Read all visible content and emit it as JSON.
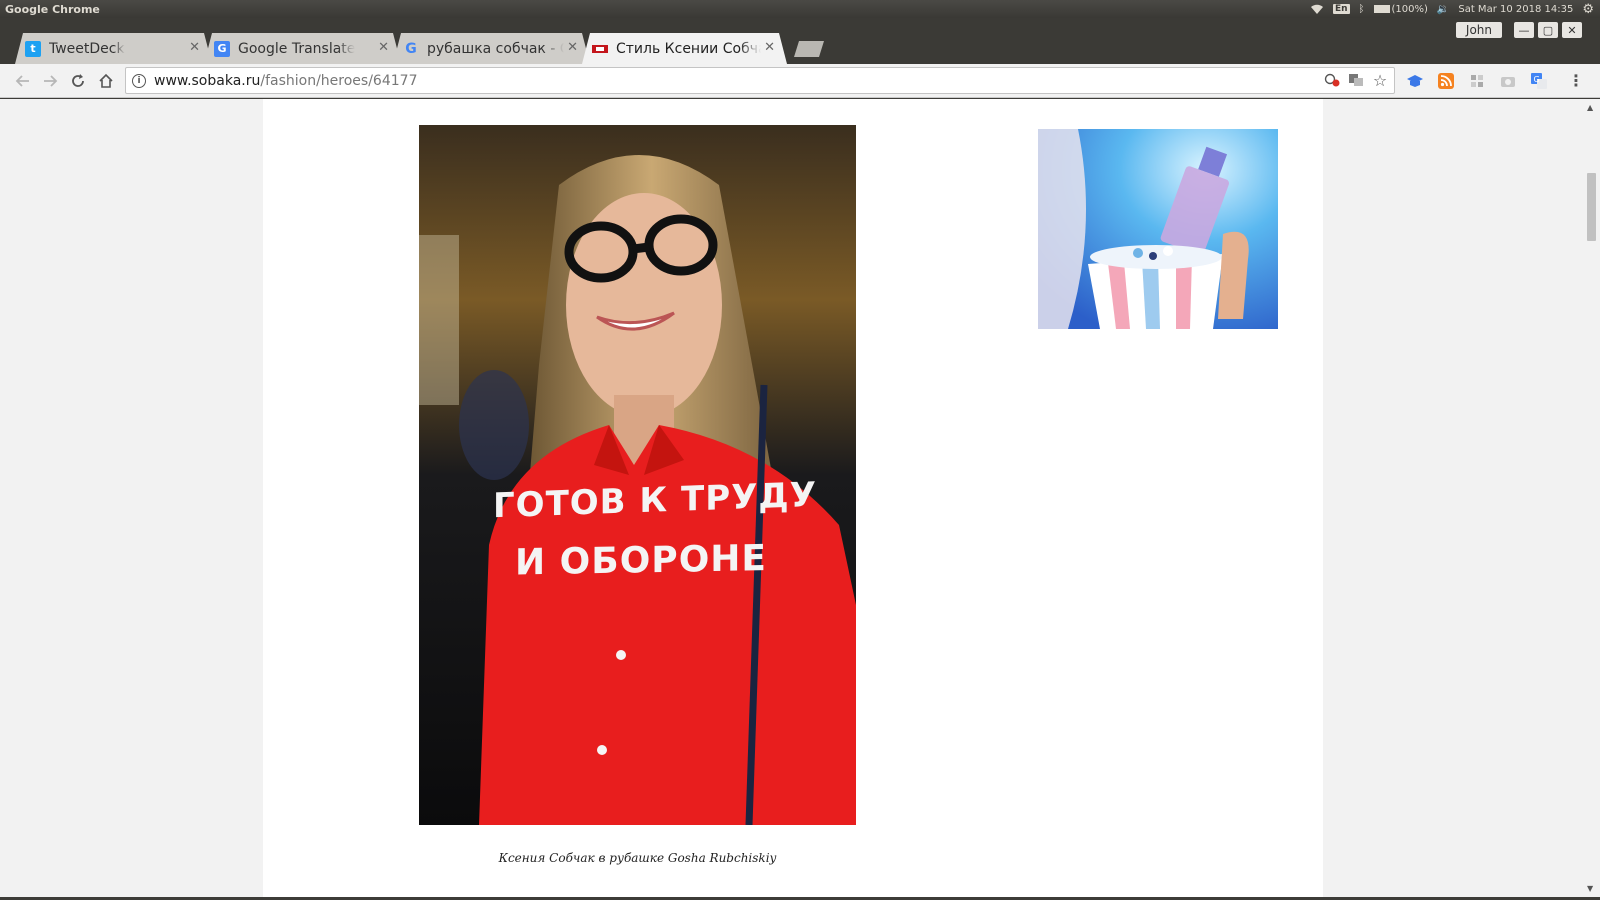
{
  "os_panel": {
    "app_name": "Google Chrome",
    "keyboard_layout": "En",
    "battery": "(100%)",
    "datetime": "Sat Mar 10 2018 14:35"
  },
  "browser": {
    "profile_name": "John",
    "tabs": [
      {
        "label": "TweetDeck",
        "favicon": "twitter-bird",
        "active": false
      },
      {
        "label": "Google Translate",
        "favicon": "google-translate",
        "active": false
      },
      {
        "label": "рубашка собчак - Goo",
        "favicon": "google-g",
        "active": false
      },
      {
        "label": "Стиль Ксении Собчак",
        "favicon": "sobaka-flag",
        "active": true
      }
    ],
    "url_host": "www.sobaka.ru",
    "url_path": "/fashion/heroes/64177"
  },
  "page": {
    "photo_caption": "Ксения Собчак в рубашке Gosha Rubchiskiy",
    "shirt_text_line1": "ГОТОВ К ТРУДУ",
    "shirt_text_line2": "И ОБОРОНЕ"
  },
  "colors": {
    "shirt_red": "#e81e1e",
    "ad_blue": "#5ab8f0",
    "page_bg": "#ffffff",
    "gutter_bg": "#f2f2f2"
  }
}
